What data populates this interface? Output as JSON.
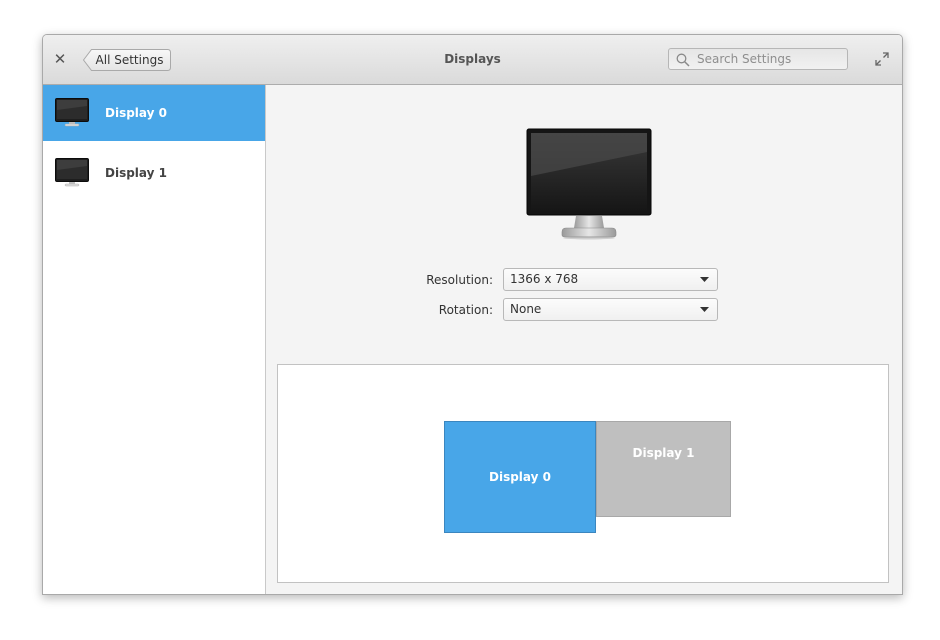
{
  "header": {
    "close_label": "✕",
    "back_label": "All Settings",
    "title": "Displays",
    "search_placeholder": "Search Settings"
  },
  "sidebar": {
    "items": [
      {
        "label": "Display 0",
        "selected": true
      },
      {
        "label": "Display 1",
        "selected": false
      }
    ]
  },
  "main": {
    "resolution_label": "Resolution:",
    "resolution_value": "1366 x 768",
    "rotation_label": "Rotation:",
    "rotation_value": "None"
  },
  "arrangement": {
    "display0_label": "Display 0",
    "display1_label": "Display 1"
  },
  "colors": {
    "accent": "#48a6e8",
    "inactive_display": "#bfbfbf"
  }
}
